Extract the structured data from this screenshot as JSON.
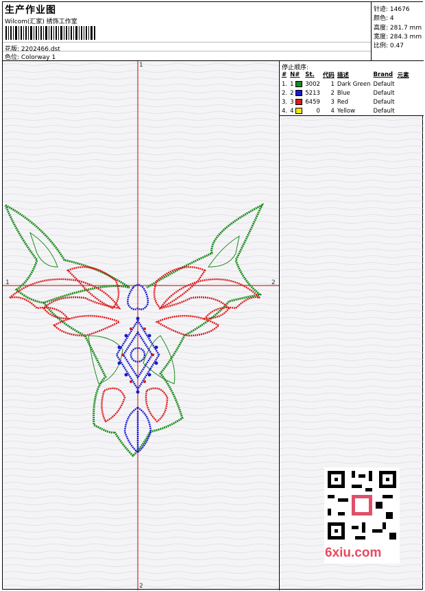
{
  "header": {
    "title": "生产作业图",
    "studio": "Wilcom(汇家) 绣饰工作室",
    "file_label": "花版:",
    "file_name": "2202466.dst",
    "colorway_label": "色位:",
    "colorway": "Colorway 1"
  },
  "stats": [
    {
      "label": "针迹:",
      "value": "14676"
    },
    {
      "label": "颜色:",
      "value": "4"
    },
    {
      "label": "高度:",
      "value": "281.7 mm"
    },
    {
      "label": "宽度:",
      "value": "284.3 mm"
    },
    {
      "label": "比例:",
      "value": "0.47"
    }
  ],
  "stop_sequence": {
    "title": "停止顺序:",
    "columns": [
      "#",
      "N#",
      "St.",
      "代码",
      "描述",
      "Brand",
      "元素"
    ],
    "rows": [
      {
        "idx": "1.",
        "n": "1",
        "color": "#1a8a1a",
        "st": "3002",
        "code": "1",
        "desc": "Dark Green",
        "brand": "Default"
      },
      {
        "idx": "2.",
        "n": "2",
        "color": "#1a1acc",
        "st": "5213",
        "code": "2",
        "desc": "Blue",
        "brand": "Default"
      },
      {
        "idx": "3.",
        "n": "3",
        "color": "#dd1a1a",
        "st": "6459",
        "code": "3",
        "desc": "Red",
        "brand": "Default"
      },
      {
        "idx": "4.",
        "n": "4",
        "color": "#f0e800",
        "st": "0",
        "code": "4",
        "desc": "Yellow",
        "brand": "Default"
      }
    ]
  },
  "axes": {
    "top": "1",
    "bottom": "2",
    "left": "1",
    "right": "2"
  },
  "watermark": "6xiu.com",
  "colors": {
    "green": "#1a8a1a",
    "blue": "#1a1acc",
    "red": "#dd1a1a",
    "axis": "#cc0000"
  }
}
